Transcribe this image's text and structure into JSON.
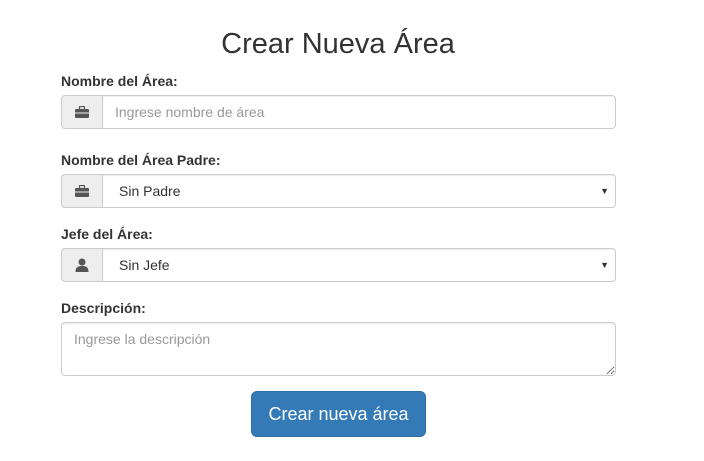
{
  "form": {
    "title": "Crear Nueva Área",
    "area_name": {
      "label": "Nombre del Área:",
      "placeholder": "Ingrese nombre de área",
      "value": "",
      "icon": "briefcase-icon"
    },
    "parent_area": {
      "label": "Nombre del Área Padre:",
      "selected": "Sin Padre",
      "icon": "briefcase-icon"
    },
    "area_head": {
      "label": "Jefe del Área:",
      "selected": "Sin Jefe",
      "icon": "user-icon"
    },
    "description": {
      "label": "Descripción:",
      "placeholder": "Ingrese la descripción",
      "value": ""
    },
    "submit_label": "Crear nueva área"
  },
  "colors": {
    "primary": "#337ab7",
    "addon_bg": "#eeeeee",
    "border": "#cccccc",
    "text": "#333333"
  }
}
